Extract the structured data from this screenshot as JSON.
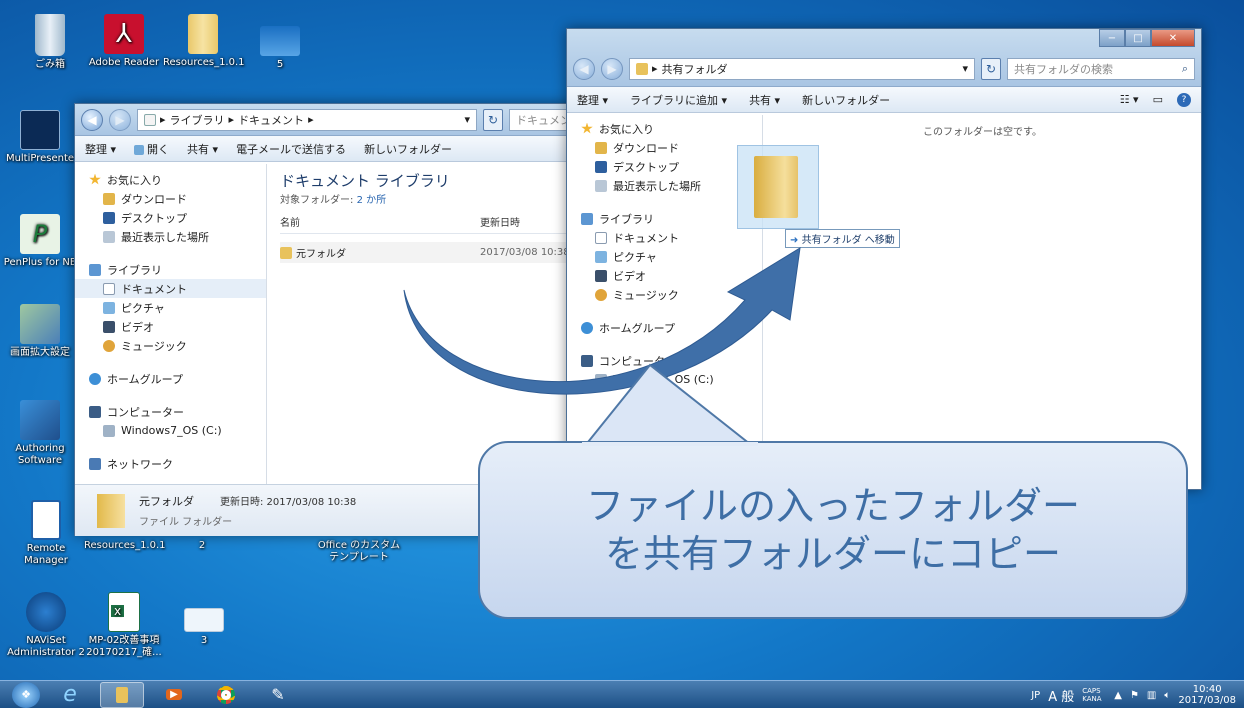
{
  "desktop": {
    "icons": [
      {
        "label": "ごみ箱"
      },
      {
        "label": "Adobe Reader"
      },
      {
        "label": "Resources_1.0.1"
      },
      {
        "label": "5"
      },
      {
        "label": "MultiPresente"
      },
      {
        "label": "PenPlus for NE"
      },
      {
        "label": "画面拡大設定"
      },
      {
        "label": "Authoring Software"
      },
      {
        "label": "Remote Manager"
      },
      {
        "label": "NAViSet Administrator 2"
      },
      {
        "label": "Resources_1.0.1"
      },
      {
        "label": "2"
      },
      {
        "label": "Office のカスタム テンプレート"
      },
      {
        "label": "MP-02改善事項 20170217_確..."
      },
      {
        "label": "3"
      }
    ]
  },
  "docs_window": {
    "address": [
      "ライブラリ",
      "ドキュメント"
    ],
    "search_placeholder": "ドキュメン",
    "toolbar": [
      "整理 ▾",
      "開く",
      "共有 ▾",
      "電子メールで送信する",
      "新しいフォルダー"
    ],
    "nav": {
      "favorites": "お気に入り",
      "favorites_items": [
        "ダウンロード",
        "デスクトップ",
        "最近表示した場所"
      ],
      "libraries": "ライブラリ",
      "library_items": [
        "ドキュメント",
        "ピクチャ",
        "ビデオ",
        "ミュージック"
      ],
      "homegroup": "ホームグループ",
      "computer": "コンピューター",
      "drive": "Windows7_OS (C:)",
      "network": "ネットワーク"
    },
    "library_title": "ドキュメント ライブラリ",
    "library_sub_prefix": "対象フォルダー: ",
    "library_sub_link": "2 か所",
    "col_name": "名前",
    "col_date": "更新日時",
    "row": {
      "name": "元フォルダ",
      "date": "2017/03/08 10:38"
    },
    "details": {
      "name": "元フォルダ",
      "date": "更新日時: 2017/03/08 10:38",
      "type": "ファイル フォルダー"
    }
  },
  "shared_window": {
    "address": [
      "共有フォルダ"
    ],
    "search_placeholder": "共有フォルダの検索",
    "toolbar": [
      "整理 ▾",
      "ライブラリに追加 ▾",
      "共有 ▾",
      "新しいフォルダー"
    ],
    "nav": {
      "favorites": "お気に入り",
      "favorites_items": [
        "ダウンロード",
        "デスクトップ",
        "最近表示した場所"
      ],
      "libraries": "ライブラリ",
      "library_items": [
        "ドキュメント",
        "ピクチャ",
        "ビデオ",
        "ミュージック"
      ],
      "homegroup": "ホームグループ",
      "computer": "コンピューター",
      "drive": "Windows7_OS (C:)"
    },
    "empty_text": "このフォルダーは空です。",
    "drag_tooltip": "共有フォルダ へ移動"
  },
  "callout": {
    "line1": "ファイルの入ったフォルダー",
    "line2": "を共有フォルダーにコピー"
  },
  "taskbar": {
    "lang": "JP",
    "ime": "A 般",
    "caps": "CAPS KANA",
    "time": "10:40",
    "date": "2017/03/08"
  },
  "colors": {
    "accent": "#3e6ea5",
    "desktop": "#1378c8",
    "arrow": "#3f6fa8"
  }
}
